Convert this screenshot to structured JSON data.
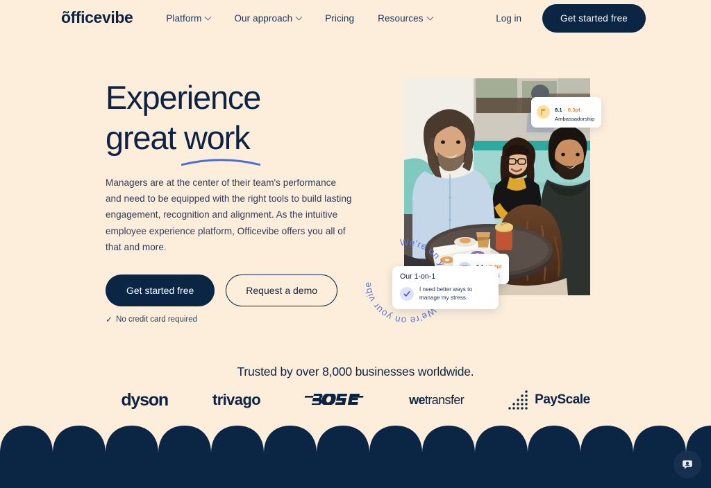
{
  "nav": {
    "logo": "õfficevibe",
    "links": [
      {
        "label": "Platform",
        "has_dropdown": true
      },
      {
        "label": "Our approach",
        "has_dropdown": true
      },
      {
        "label": "Pricing",
        "has_dropdown": false
      },
      {
        "label": "Resources",
        "has_dropdown": true
      }
    ],
    "login_label": "Log in",
    "cta_label": "Get started free"
  },
  "hero": {
    "headline_line1": "Experience",
    "headline_line2_prefix": "great ",
    "headline_line2_underlined": "work",
    "body": "Managers are at the center of their team's performance and need to be equipped with the right tools to build lasting engagement, recognition and alignment. As the intuitive employee experience platform, Officevibe offers you all of that and more.",
    "cta_primary": "Get started free",
    "cta_secondary": "Request a demo",
    "no_credit_card": "No credit card required",
    "check_glyph": "✓"
  },
  "cards": {
    "ambassadorship": {
      "score": "8.1",
      "delta": "↑ 0.3pt",
      "label": "Ambassadorship",
      "icon": "flag-icon",
      "icon_bg": "#fcdf9b"
    },
    "feedback": {
      "score": "6.1",
      "delta": "↑ 0.3pt",
      "label": "Feedback",
      "icon": "chat-bubble-icon",
      "icon_bg": "#d9ddfb"
    },
    "one_on_one": {
      "title": "Our 1-on-1",
      "item_text": "I need better ways to manage my stress.",
      "icon": "check-icon"
    },
    "vibe_ring_text": "We're on your vibe. We're on your vibe. "
  },
  "trusted": {
    "heading": "Trusted by over 8,000 businesses worldwide.",
    "logos": [
      {
        "name": "dyson",
        "label": "dyson"
      },
      {
        "name": "trivago",
        "label": "trivago"
      },
      {
        "name": "bose",
        "label": "BOSE"
      },
      {
        "name": "wetransfer",
        "label_bold": "we",
        "label_rest": "transfer"
      },
      {
        "name": "payscale",
        "label": "PayScale"
      }
    ]
  },
  "chat": {
    "icon": "chat-widget-icon"
  },
  "colors": {
    "background": "#fdeedc",
    "navy": "#0b2545",
    "text_navy": "#0d2344",
    "accent_blue": "#4a6fd4",
    "accent_orange": "#f08a3c",
    "card_yellow": "#fcdf9b",
    "card_periwinkle": "#d9ddfb"
  }
}
